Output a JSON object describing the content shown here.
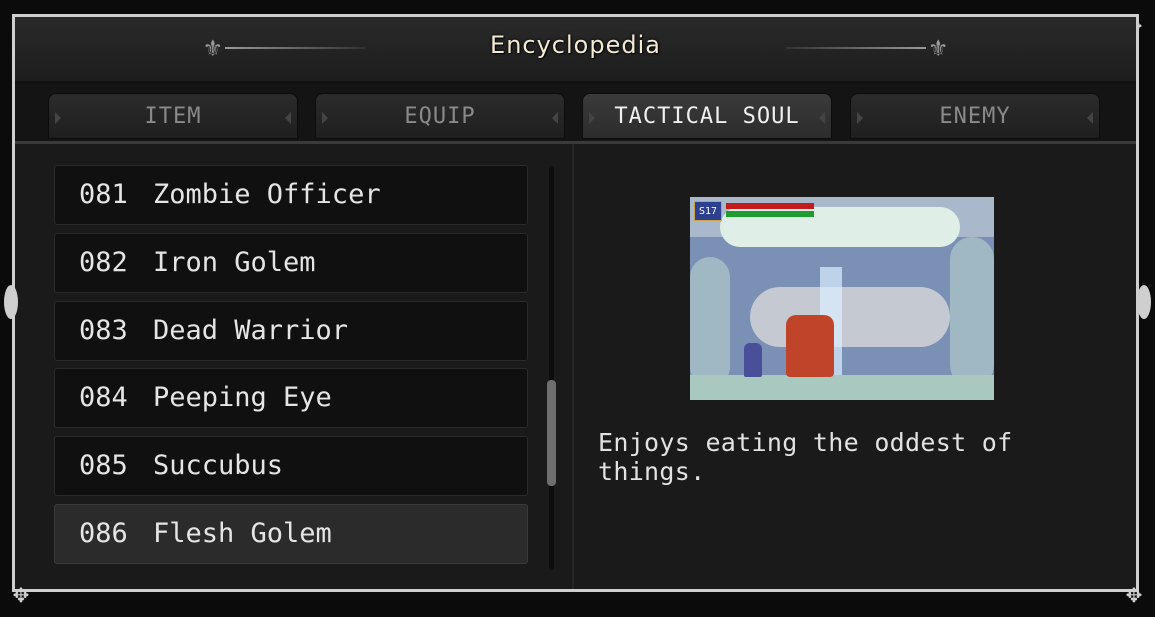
{
  "header": {
    "title": "Encyclopedia"
  },
  "tabs": [
    {
      "label": "ITEM",
      "active": false
    },
    {
      "label": "EQUIP",
      "active": false
    },
    {
      "label": "TACTICAL SOUL",
      "active": true
    },
    {
      "label": "ENEMY",
      "active": false
    }
  ],
  "list": {
    "items": [
      {
        "num": "081",
        "name": "Zombie Officer"
      },
      {
        "num": "082",
        "name": "Iron Golem"
      },
      {
        "num": "083",
        "name": "Dead Warrior"
      },
      {
        "num": "084",
        "name": "Peeping Eye"
      },
      {
        "num": "085",
        "name": "Succubus"
      },
      {
        "num": "086",
        "name": "Flesh Golem"
      }
    ],
    "selected_index": 5
  },
  "preview": {
    "hud_mp": "S17"
  },
  "detail": {
    "description": "Enjoys eating the oddest of things."
  },
  "colors": {
    "accent_title": "#f3ead2",
    "hp_bar": "#c21b1b",
    "mp_bar": "#1f9b31"
  }
}
